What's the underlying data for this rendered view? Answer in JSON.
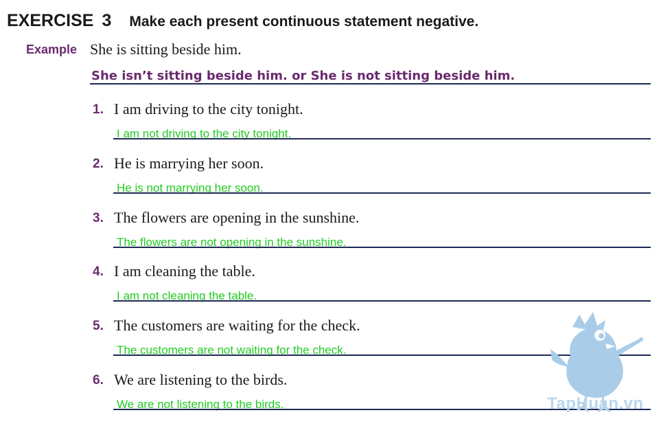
{
  "header": {
    "exercise_label": "EXERCISE",
    "exercise_number": "3",
    "instruction": "Make each present continuous statement negative."
  },
  "example": {
    "label": "Example",
    "sentence": "She is sitting beside him.",
    "answer": "She isn’t sitting beside him. or She is not sitting beside him."
  },
  "items": [
    {
      "number": "1.",
      "text": "I am driving to the city tonight.",
      "answer": "I am not driving to the city tonight."
    },
    {
      "number": "2.",
      "text": "He is marrying her soon.",
      "answer": "He is not marrying her soon."
    },
    {
      "number": "3.",
      "text": "The flowers are opening in the sunshine.",
      "answer": "The flowers are not opening in the sunshine."
    },
    {
      "number": "4.",
      "text": "I am cleaning the table.",
      "answer": "I am not cleaning the table."
    },
    {
      "number": "5.",
      "text": "The customers are waiting for the check.",
      "answer": "The customers are not waiting for the check."
    },
    {
      "number": "6.",
      "text": "We are listening to the birds.",
      "answer": "We are not listening to the birds."
    }
  ],
  "watermark": {
    "text": "TapHuan.vn",
    "icon": "bird-mascot-icon"
  },
  "colors": {
    "accent_purple": "#6a2a6e",
    "answer_green": "#22cc22",
    "rule_navy": "#1f2a55",
    "watermark_blue": "#b9d6ee"
  }
}
